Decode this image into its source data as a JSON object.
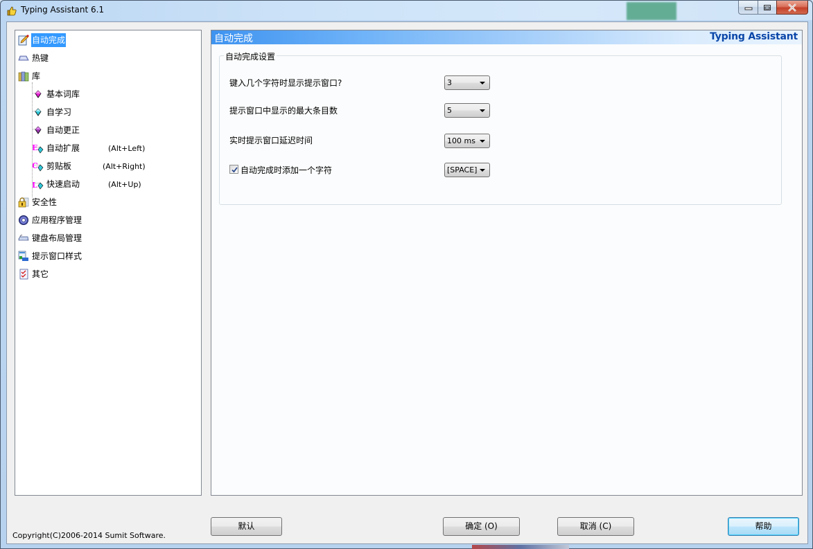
{
  "window": {
    "title": "Typing Assistant 6.1",
    "caption_buttons": [
      "minimize",
      "maximize",
      "close"
    ]
  },
  "tree": {
    "items": [
      {
        "label": "自动完成",
        "icon": "pencil-note-icon",
        "selected": true,
        "level": 0
      },
      {
        "label": "热键",
        "icon": "keyboard-key-icon",
        "selected": false,
        "level": 0
      },
      {
        "label": "库",
        "icon": "books-icon",
        "selected": false,
        "level": 0
      },
      {
        "label": "基本词库",
        "icon": "magenta-gem-icon",
        "selected": false,
        "level": 1
      },
      {
        "label": "自学习",
        "icon": "cyan-gem-icon",
        "selected": false,
        "level": 1
      },
      {
        "label": "自动更正",
        "icon": "purple-gem-icon",
        "selected": false,
        "level": 1
      },
      {
        "label": "自动扩展",
        "icon": "letter-e-gem-icon",
        "hotkey": "(Alt+Left)",
        "selected": false,
        "level": 1
      },
      {
        "label": "剪贴板",
        "icon": "letter-c-gem-icon",
        "hotkey": "(Alt+Right)",
        "selected": false,
        "level": 1
      },
      {
        "label": "快速启动",
        "icon": "letter-l-gem-icon",
        "hotkey": "(Alt+Up)",
        "selected": false,
        "level": 1
      },
      {
        "label": "安全性",
        "icon": "lock-icon",
        "selected": false,
        "level": 0
      },
      {
        "label": "应用程序管理",
        "icon": "gear-icon",
        "selected": false,
        "level": 0
      },
      {
        "label": "键盘布局管理",
        "icon": "keyboard-icon",
        "selected": false,
        "level": 0
      },
      {
        "label": "提示窗口样式",
        "icon": "window-style-icon",
        "selected": false,
        "level": 0
      },
      {
        "label": "其它",
        "icon": "checklist-icon",
        "selected": false,
        "level": 0
      }
    ]
  },
  "panel": {
    "title": "自动完成",
    "brand": "Typing Assistant",
    "group_title": "自动完成设置",
    "settings": [
      {
        "label": "键入几个字符时显示提示窗口?",
        "value": "3"
      },
      {
        "label": "提示窗口中显示的最大条目数",
        "value": "5"
      },
      {
        "label": "实时提示窗口延迟时间",
        "value": "100 ms"
      },
      {
        "label": "自动完成时添加一个字符",
        "value": "[SPACE]",
        "checkbox": true,
        "checked": true
      }
    ]
  },
  "footer": {
    "copyright": "Copyright(C)2006-2014  Sumit Software.",
    "buttons": {
      "default": "默认",
      "ok": "确定 (O)",
      "cancel": "取消 (C)",
      "help": "帮助"
    }
  },
  "colors": {
    "selection": "#3399ff",
    "header_gradient_start": "#3e93f0",
    "brand_text": "#0a46a8",
    "hotkey_letter": "#ff00ff"
  }
}
